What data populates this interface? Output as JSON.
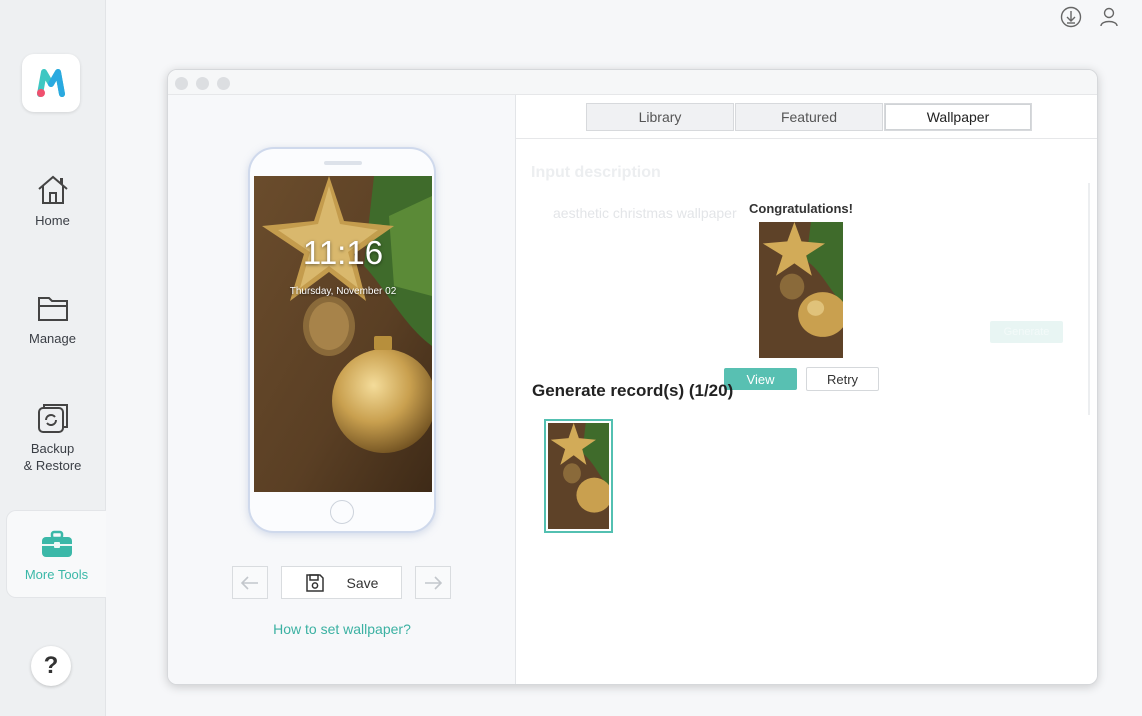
{
  "sidebar": {
    "items": [
      {
        "label": "Home",
        "icon": "home-icon"
      },
      {
        "label": "Manage",
        "icon": "folder-icon"
      },
      {
        "label": "Backup\n& Restore",
        "icon": "backup-icon"
      },
      {
        "label": "More Tools",
        "icon": "toolbox-icon"
      }
    ],
    "help_label": "?"
  },
  "header": {
    "icons": [
      "download-icon",
      "user-icon"
    ]
  },
  "preview": {
    "lock_time": "11:16",
    "lock_date": "Thursday, November 02",
    "save_label": "Save",
    "howto_link": "How to set wallpaper?"
  },
  "tabs": [
    {
      "label": "Library",
      "active": false
    },
    {
      "label": "Featured",
      "active": false
    },
    {
      "label": "Wallpaper",
      "active": true
    }
  ],
  "generator": {
    "input_heading": "Input description",
    "prompt_text": "aesthetic christmas wallpaper",
    "generate_label": "Generate"
  },
  "result_popup": {
    "title": "Congratulations!",
    "view_label": "View",
    "retry_label": "Retry"
  },
  "records": {
    "title": "Generate record(s) (1/20)",
    "count": 1
  },
  "colors": {
    "accent": "#58c0b2",
    "link": "#3bb1a2",
    "tool_active": "#3bb8a8"
  }
}
